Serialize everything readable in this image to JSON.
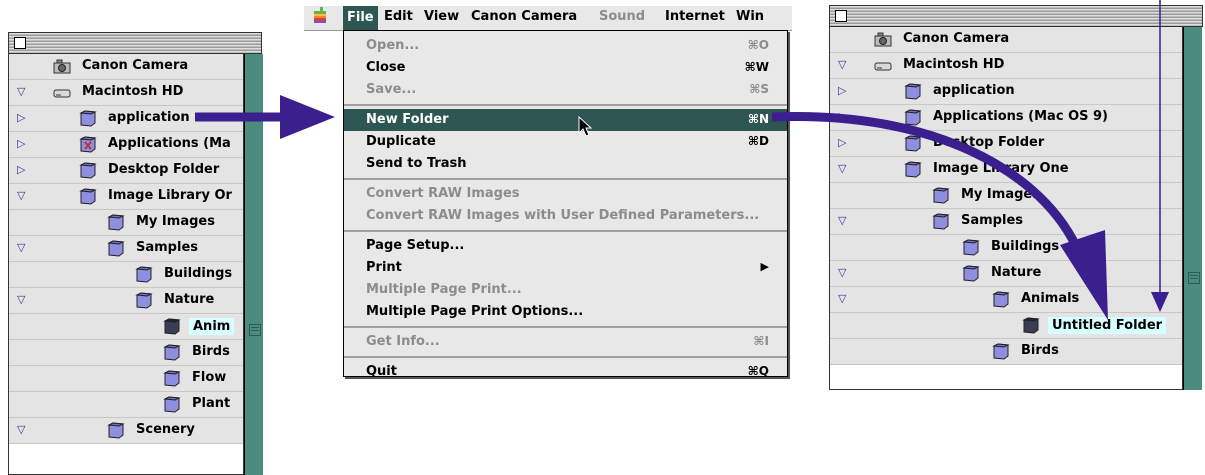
{
  "left_window": {
    "rows": [
      {
        "label": "Canon Camera",
        "tri": "",
        "icon": "camera"
      },
      {
        "label": "Macintosh HD",
        "tri": "down",
        "icon": "disk"
      },
      {
        "label": "application",
        "tri": "right",
        "icon": "folder"
      },
      {
        "label": "Applications (Ma",
        "tri": "right",
        "icon": "appfolder"
      },
      {
        "label": "Desktop Folder",
        "tri": "right",
        "icon": "folder"
      },
      {
        "label": "Image Library Or",
        "tri": "down",
        "icon": "folder"
      },
      {
        "label": "My Images",
        "tri": "",
        "icon": "folder"
      },
      {
        "label": "Samples",
        "tri": "down",
        "icon": "folder"
      },
      {
        "label": "Buildings",
        "tri": "",
        "icon": "folder"
      },
      {
        "label": "Nature",
        "tri": "down",
        "icon": "folder"
      },
      {
        "label": "Anim",
        "tri": "",
        "icon": "darkfolder",
        "highlight": true
      },
      {
        "label": "Birds",
        "tri": "",
        "icon": "folder"
      },
      {
        "label": "Flow",
        "tri": "",
        "icon": "folder"
      },
      {
        "label": "Plant",
        "tri": "",
        "icon": "folder"
      },
      {
        "label": "Scenery",
        "tri": "down",
        "icon": "folder"
      }
    ]
  },
  "menubar": {
    "apple_icon": "apple-logo-icon",
    "items": [
      "File",
      "Edit",
      "View",
      "Canon Camera",
      "Sound",
      "Internet",
      "Win"
    ]
  },
  "file_menu": {
    "items": [
      {
        "label": "Open...",
        "key": "⌘O",
        "disabled": true
      },
      {
        "label": "Close",
        "key": "⌘W"
      },
      {
        "label": "Save...",
        "key": "⌘S",
        "disabled": true
      },
      {
        "sep": true
      },
      {
        "label": "New Folder",
        "key": "⌘N",
        "selected": true
      },
      {
        "label": "Duplicate",
        "key": "⌘D"
      },
      {
        "label": "Send to Trash",
        "key": ""
      },
      {
        "sep": true
      },
      {
        "label": "Convert RAW Images",
        "key": "",
        "disabled": true
      },
      {
        "label": "Convert RAW Images with User Defined Parameters...",
        "key": "",
        "disabled": true
      },
      {
        "sep": true
      },
      {
        "label": "Page Setup...",
        "key": ""
      },
      {
        "label": "Print",
        "key": "",
        "submenu": true
      },
      {
        "label": "Multiple Page Print...",
        "key": "",
        "disabled": true
      },
      {
        "label": "Multiple Page Print Options...",
        "key": ""
      },
      {
        "sep": true
      },
      {
        "label": "Get Info...",
        "key": "⌘I",
        "disabled": true
      },
      {
        "sep": true
      },
      {
        "label": "Quit",
        "key": "⌘Q"
      }
    ]
  },
  "right_window": {
    "rows": [
      {
        "label": "Canon Camera",
        "tri": "",
        "icon": "camera"
      },
      {
        "label": "Macintosh HD",
        "tri": "down",
        "icon": "disk"
      },
      {
        "label": "application",
        "tri": "right",
        "icon": "folder"
      },
      {
        "label": "Applications (Mac OS 9)",
        "tri": "right",
        "icon": "folder"
      },
      {
        "label": "Desktop Folder",
        "tri": "right",
        "icon": "folder"
      },
      {
        "label": "Image Library One",
        "tri": "down",
        "icon": "folder"
      },
      {
        "label": "My Images",
        "tri": "",
        "icon": "folder"
      },
      {
        "label": "Samples",
        "tri": "down",
        "icon": "folder"
      },
      {
        "label": "Buildings",
        "tri": "",
        "icon": "folder"
      },
      {
        "label": "Nature",
        "tri": "down",
        "icon": "folder"
      },
      {
        "label": "Animals",
        "tri": "down",
        "icon": "folder"
      },
      {
        "label": "Untitled Folder",
        "tri": "",
        "icon": "darkfolder",
        "highlight": true
      },
      {
        "label": "Birds",
        "tri": "",
        "icon": "folder"
      }
    ]
  },
  "colors": {
    "accent": "#2e5753",
    "arrow": "#3b1f8f",
    "scrollbar": "#4b8b80",
    "highlight": "#d8ffff"
  }
}
